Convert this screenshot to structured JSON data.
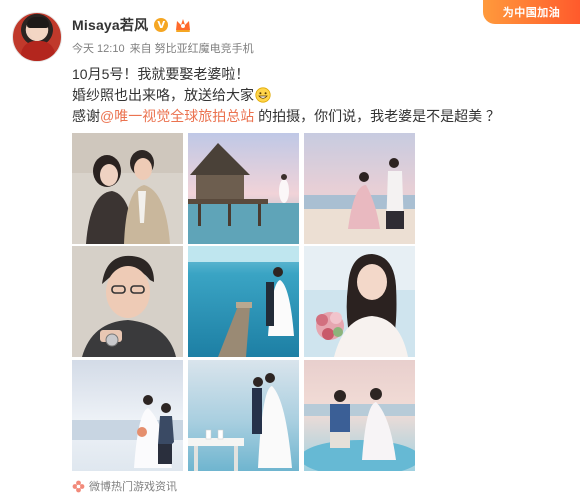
{
  "post": {
    "username": "Misaya若风",
    "verified_badge": "V",
    "promo": "为中国加油",
    "time": "今天 12:10",
    "source": "来自 努比亚红魔电竞手机",
    "text_line1": "10月5号！我就要娶老婆啦！",
    "text_line2": "婚纱照也出来咯，放送给大家",
    "text_line3_prefix": "感谢",
    "mention": "@唯一视觉全球旅拍总站",
    "text_line3_suffix": " 的拍摄，你们说，我老婆是不是超美 ？",
    "emoji": "smile-emoji",
    "topic_footer": "微博热门游戏资讯"
  },
  "colors": {
    "link": "#eb7350",
    "meta": "#808080",
    "badge": "#f5a623",
    "promo_start": "#ff9a3c",
    "promo_end": "#ff5a2c"
  },
  "photos": [
    {
      "alt": "photo-1-couple-studio"
    },
    {
      "alt": "photo-2-overwater-villa"
    },
    {
      "alt": "photo-3-beach-sunset"
    },
    {
      "alt": "photo-4-groom-portrait"
    },
    {
      "alt": "photo-5-pier-ocean"
    },
    {
      "alt": "photo-6-bride-bouquet"
    },
    {
      "alt": "photo-7-proposal-beach"
    },
    {
      "alt": "photo-8-beach-table"
    },
    {
      "alt": "photo-9-couple-pool"
    }
  ]
}
